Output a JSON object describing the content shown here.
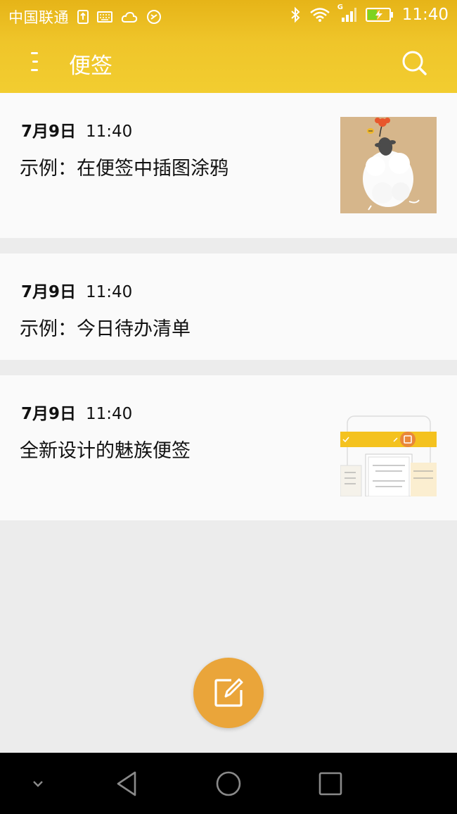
{
  "status_bar": {
    "carrier": "中国联通",
    "network": "G",
    "time": "11:40"
  },
  "app_bar": {
    "title": "便签",
    "menu_icon": "menu-icon",
    "search_icon": "search-icon"
  },
  "notes": [
    {
      "date": "7月9日",
      "time": "11:40",
      "title": "示例：在便签中插图涂鸦",
      "thumbnail": "sheep-illustration"
    },
    {
      "date": "7月9日",
      "time": "11:40",
      "title": "示例：今日待办清单"
    },
    {
      "date": "7月9日",
      "time": "11:40",
      "title": "全新设计的魅族便签",
      "thumbnail": "app-screenshot-preview"
    }
  ],
  "fab": {
    "icon": "edit-icon"
  },
  "colors": {
    "accent": "#f2cd30",
    "fab": "#eaa53a",
    "background": "#ececec",
    "card": "#fafafa"
  }
}
